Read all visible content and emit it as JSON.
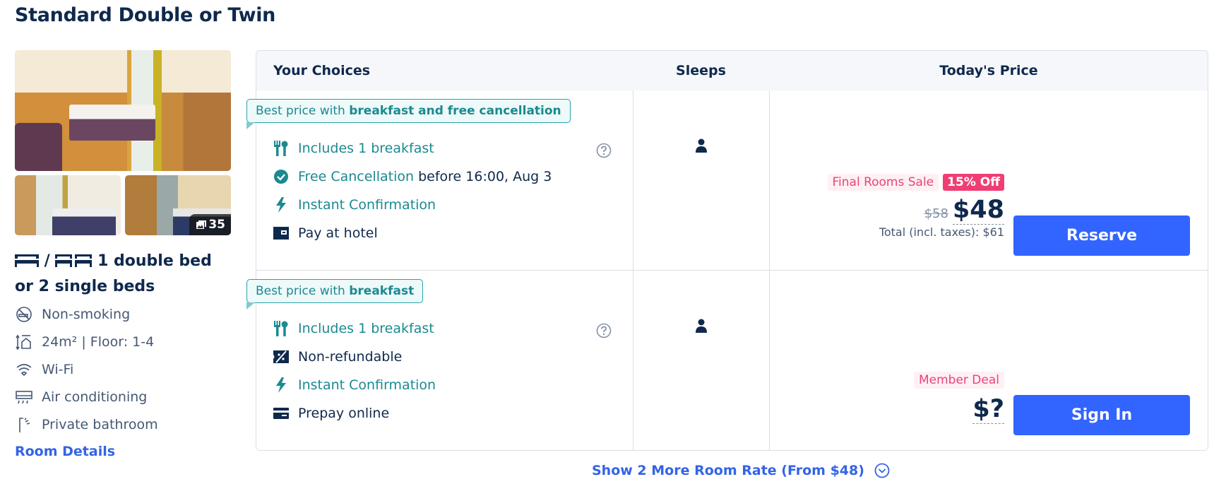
{
  "room": {
    "title": "Standard Double or Twin",
    "photo_count": "35",
    "bed_description": "1 double bed or 2 single beds",
    "bed_separator": "/",
    "amenities": [
      {
        "icon": "no-smoking-icon",
        "label": "Non-smoking"
      },
      {
        "icon": "room-size-icon",
        "label": "24m² | Floor: 1-4"
      },
      {
        "icon": "wifi-icon",
        "label": "Wi-Fi"
      },
      {
        "icon": "air-conditioning-icon",
        "label": "Air conditioning"
      },
      {
        "icon": "shower-icon",
        "label": "Private bathroom"
      }
    ],
    "details_link": "Room Details"
  },
  "table": {
    "headers": {
      "choices": "Your Choices",
      "sleeps": "Sleeps",
      "price": "Today's Price"
    },
    "rows": [
      {
        "promo_prefix": "Best price with ",
        "promo_bold": "breakfast and free cancellation",
        "features": [
          {
            "icon": "breakfast-icon",
            "text": "Includes 1 breakfast",
            "suffix": ""
          },
          {
            "icon": "check-circle-icon",
            "text": "Free Cancellation",
            "suffix": " before 16:00, Aug 3"
          },
          {
            "icon": "lightning-icon",
            "text": "Instant Confirmation",
            "suffix": ""
          },
          {
            "icon": "wallet-icon",
            "text": "Pay at hotel",
            "suffix": ""
          }
        ],
        "sleeps": 1,
        "sale_label": "Final Rooms Sale",
        "discount": "15% Off",
        "original_price": "$58",
        "price": "$48",
        "total": "Total (incl. taxes): $61",
        "button": "Reserve"
      },
      {
        "promo_prefix": "Best price with ",
        "promo_bold": "breakfast",
        "features": [
          {
            "icon": "breakfast-icon",
            "text": "Includes 1 breakfast",
            "suffix": ""
          },
          {
            "icon": "non-refundable-icon",
            "text": "Non-refundable",
            "suffix": ""
          },
          {
            "icon": "lightning-icon",
            "text": "Instant Confirmation",
            "suffix": ""
          },
          {
            "icon": "credit-card-icon",
            "text": "Prepay online",
            "suffix": ""
          }
        ],
        "sleeps": 1,
        "sale_label": "Member Deal",
        "price": "$?",
        "button": "Sign In"
      }
    ]
  },
  "show_more": "Show 2 More Room Rate (From $48)",
  "colors": {
    "primary": "#3264ff",
    "link": "#3264e6",
    "teal": "#1a8a90",
    "sale_pink": "#f03e73",
    "text_dark": "#0f294d"
  }
}
